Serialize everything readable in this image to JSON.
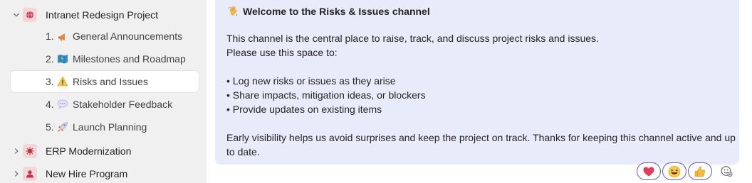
{
  "sidebar": {
    "team": {
      "label": "Intranet Redesign Project",
      "avatar_color": "#c4314b",
      "icon": "globe-icon"
    },
    "channels": [
      {
        "number": "1.",
        "label": "General Announcements",
        "icon": "megaphone-icon"
      },
      {
        "number": "2.",
        "label": "Milestones and Roadmap",
        "icon": "map-icon"
      },
      {
        "number": "3.",
        "label": "Risks and Issues",
        "icon": "warning-icon",
        "active": true
      },
      {
        "number": "4.",
        "label": "Stakeholder Feedback",
        "icon": "speech-bubble-icon"
      },
      {
        "number": "5.",
        "label": "Launch Planning",
        "icon": "rocket-icon"
      }
    ],
    "other_teams": [
      {
        "label": "ERP Modernization",
        "avatar_color": "#c4314b",
        "icon": "virus-icon"
      },
      {
        "label": "New Hire Program",
        "avatar_color": "#c4314b",
        "icon": "person-icon"
      }
    ]
  },
  "message": {
    "title_icon": "waving-hand-icon",
    "title": "Welcome to the Risks & Issues channel",
    "lines": [
      "This channel is the central place to raise, track, and discuss project risks and issues.",
      "Please use this space to:",
      "• Log new risks or issues as they arise",
      "• Share impacts, mitigation ideas, or blockers",
      "• Provide updates on existing items",
      "Early visibility helps us avoid surprises and keep the project on track. Thanks for keeping this channel active and up",
      "to date."
    ],
    "background_color": "#e8ebfa"
  },
  "reactions": [
    {
      "icon": "heart-icon"
    },
    {
      "icon": "laughing-face-icon"
    },
    {
      "icon": "thumbs-up-icon"
    }
  ],
  "add_reaction_icon": "add-reaction-icon",
  "colors": {
    "accent": "#5b5fc7",
    "sidebar_bg": "#f0f0f0"
  }
}
